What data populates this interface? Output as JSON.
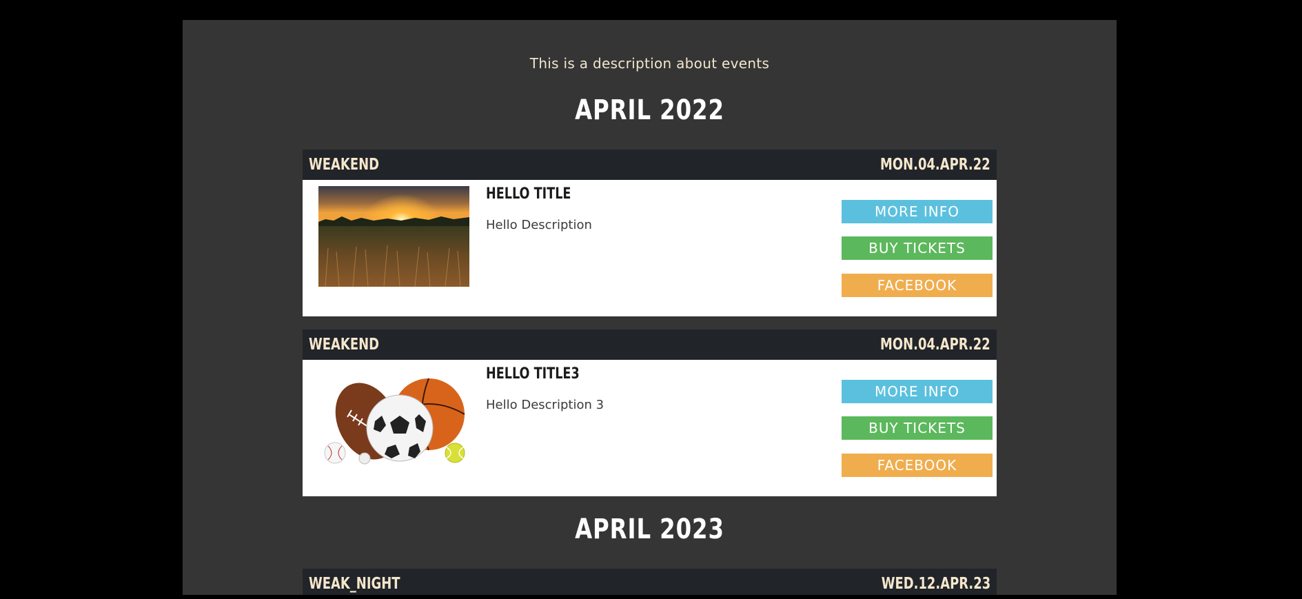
{
  "intro_text": "This is a description about events",
  "months": [
    {
      "label": "APRIL 2022"
    },
    {
      "label": "APRIL 2023"
    }
  ],
  "events": [
    {
      "tag": "WEAKEND",
      "date": "MON.04.APR.22",
      "title": "HELLO TITLE",
      "description": "Hello Description",
      "image": "sunset-field-image",
      "buttons": {
        "more_info": "MORE INFO",
        "buy_tickets": "BUY TICKETS",
        "facebook": "FACEBOOK"
      }
    },
    {
      "tag": "WEAKEND",
      "date": "MON.04.APR.22",
      "title": "HELLO TITLE3",
      "description": "Hello Description 3",
      "image": "sports-balls-image",
      "buttons": {
        "more_info": "MORE INFO",
        "buy_tickets": "BUY TICKETS",
        "facebook": "FACEBOOK"
      }
    },
    {
      "tag": "WEAK_NIGHT",
      "date": "WED.12.APR.23"
    }
  ],
  "colors": {
    "page_bg": "#353535",
    "header_bg": "#212429",
    "header_text": "#f5e7cc",
    "more_info": "#5bc0de",
    "buy_tickets": "#5cb85c",
    "facebook": "#f0ad4e"
  }
}
